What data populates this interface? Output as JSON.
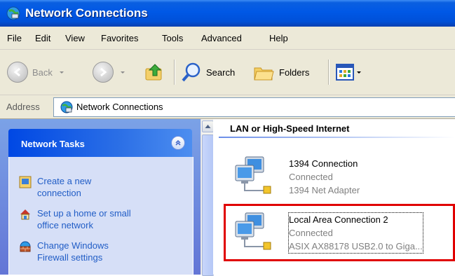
{
  "window": {
    "title": "Network Connections",
    "title_color": "#0058e6"
  },
  "menu": [
    "File",
    "Edit",
    "View",
    "Favorites",
    "Tools",
    "Advanced",
    "Help"
  ],
  "toolbar": {
    "back_label": "Back",
    "search_label": "Search",
    "folders_label": "Folders"
  },
  "address": {
    "label": "Address",
    "value": "Network Connections"
  },
  "tasks": {
    "header": "Network Tasks",
    "items": [
      {
        "label_line1": "Create a new",
        "label_line2": "connection",
        "icon": "new-connection-icon"
      },
      {
        "label_line1": "Set up a home or small",
        "label_line2": "office network",
        "icon": "home-network-icon"
      },
      {
        "label_line1": "Change Windows",
        "label_line2": "Firewall settings",
        "icon": "firewall-icon"
      }
    ],
    "link_color": "#215dc6"
  },
  "content": {
    "group_header": "LAN or High-Speed Internet",
    "connections": [
      {
        "name": "1394 Connection",
        "status": "Connected",
        "adapter": "1394 Net Adapter"
      },
      {
        "name": "Local Area Connection 2",
        "status": "Connected",
        "adapter": "ASIX AX88178 USB2.0 to Giga..."
      }
    ],
    "highlight_color": "#e00000"
  }
}
